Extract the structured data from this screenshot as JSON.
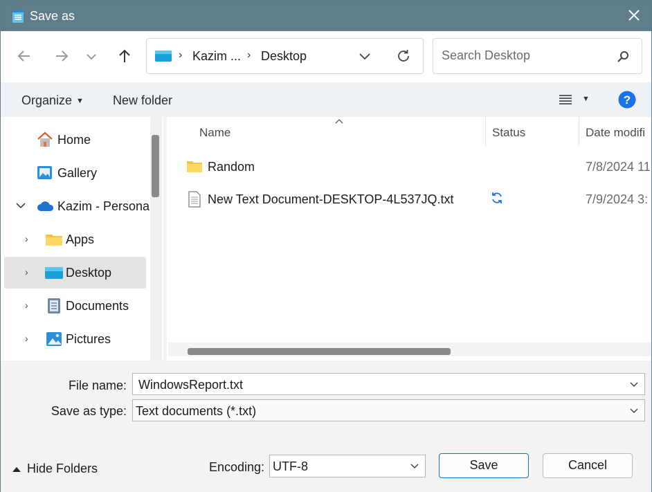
{
  "window": {
    "title": "Save as"
  },
  "nav": {
    "breadcrumbs": [
      "Kazim ...",
      "Desktop"
    ],
    "search_placeholder": "Search Desktop"
  },
  "toolbar": {
    "organize": "Organize",
    "new_folder": "New folder"
  },
  "sidebar": {
    "items": [
      {
        "label": "Home",
        "icon": "home-icon"
      },
      {
        "label": "Gallery",
        "icon": "gallery-icon"
      },
      {
        "label": "Kazim - Personal",
        "icon": "onedrive-cloud-icon"
      },
      {
        "label": "Apps",
        "icon": "folder-icon"
      },
      {
        "label": "Desktop",
        "icon": "desktop-icon",
        "selected": true
      },
      {
        "label": "Documents",
        "icon": "documents-icon"
      },
      {
        "label": "Pictures",
        "icon": "pictures-icon"
      }
    ]
  },
  "columns": {
    "name": "Name",
    "status": "Status",
    "date": "Date modifi"
  },
  "files": [
    {
      "name": "Random",
      "type": "folder",
      "status": "",
      "date": "7/8/2024 11"
    },
    {
      "name": "New Text Document-DESKTOP-4L537JQ.txt",
      "type": "text-file",
      "status": "sync-icon",
      "date": "7/9/2024 3:"
    }
  ],
  "form": {
    "file_name_label": "File name:",
    "file_name_value": "WindowsReport.txt",
    "type_label": "Save as type:",
    "type_value": "Text documents (*.txt)",
    "encoding_label": "Encoding:",
    "encoding_value": "UTF-8"
  },
  "buttons": {
    "save": "Save",
    "cancel": "Cancel",
    "hide_folders": "Hide Folders"
  },
  "colors": {
    "titlebar": "#607d8b",
    "accent": "#1f6fc0",
    "help": "#1a73e8"
  }
}
